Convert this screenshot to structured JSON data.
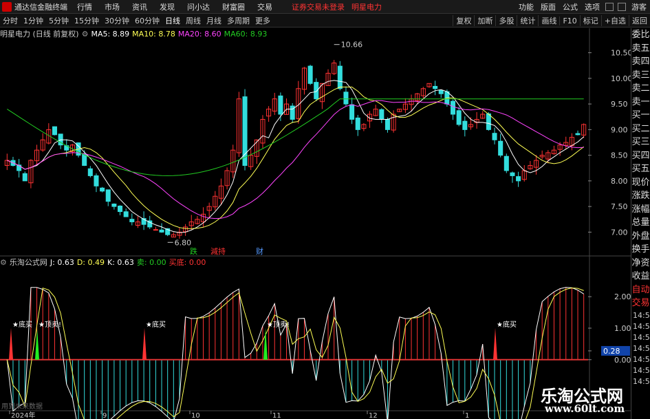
{
  "menubar": {
    "app_name": "通达信金融终端",
    "items": [
      "行情",
      "市场",
      "资讯",
      "发现",
      "问小达",
      "财富圈",
      "交易"
    ],
    "alert": "证券交易未登录",
    "stock_name": "明星电力",
    "right_items": [
      "功能",
      "版面",
      "公式",
      "选项"
    ],
    "guest": "游客"
  },
  "periods": [
    "分时",
    "1分钟",
    "5分钟",
    "15分钟",
    "30分钟",
    "60分钟",
    "日线",
    "周线",
    "月线",
    "多周期",
    "更多"
  ],
  "active_period": "日线",
  "tools": [
    "复权",
    "加断",
    "多股",
    "统计",
    "画线",
    "F10",
    "标记",
    "+自选",
    "返回"
  ],
  "main_legend": {
    "title": "明星电力 (日线 前复权)",
    "ma5": "MA5: 8.89",
    "ma10": "MA10: 8.78",
    "ma20": "MA20: 8.60",
    "ma60": "MA60: 8.93"
  },
  "sub_legend": {
    "title": "乐淘公式网",
    "j": "J: 0.63",
    "d": "D: 0.49",
    "k": "K: 0.63",
    "sell": "卖: 0.00",
    "buy": "买底: 0.00"
  },
  "price_axis": [
    "10.50",
    "10.00",
    "9.50",
    "9.00",
    "8.50",
    "8.00",
    "7.50",
    "7.00"
  ],
  "high_label": "10.66",
  "low_label": "6.80",
  "event_labels": [
    "跌",
    "減持",
    "财"
  ],
  "sub_axis": [
    "2.00",
    "1.00",
    "0.28",
    "0.00"
  ],
  "time_axis": [
    "2024年",
    "9",
    "10",
    "11",
    "12",
    "1"
  ],
  "signals": {
    "buy": "底买",
    "sell": "顶卖!"
  },
  "right_panel": [
    "委比",
    "卖五",
    "卖四",
    "卖三",
    "卖二",
    "卖一",
    "买一",
    "买二",
    "买三",
    "买四",
    "买五",
    "现价",
    "涨跌",
    "涨幅",
    "总量",
    "外盘",
    "换手",
    "净资",
    "收益",
    "自动",
    "交易"
  ],
  "right_times": [
    "14:5",
    "14:5",
    "14:5",
    "14:5",
    "14:5",
    "14:5",
    "14:5"
  ],
  "future_note": "用到未来数据",
  "watermark": {
    "line1": "乐淘公式网",
    "line2": "www.60lt.com"
  },
  "colors": {
    "up": "#ff3333",
    "down": "#33dddd",
    "ma5": "#ffffff",
    "ma10": "#ffff55",
    "ma20": "#ff44ff",
    "ma60": "#22cc22"
  },
  "chart_data": {
    "type": "candlestick",
    "y_range": [
      6.75,
      10.75
    ],
    "closes": [
      8.4,
      8.3,
      8.2,
      8.0,
      8.4,
      8.6,
      8.8,
      9.0,
      8.9,
      8.7,
      8.6,
      8.7,
      8.5,
      8.3,
      8.1,
      7.9,
      7.8,
      7.6,
      7.5,
      7.4,
      7.3,
      7.2,
      7.2,
      7.15,
      7.1,
      7.05,
      7.0,
      6.95,
      6.95,
      7.0,
      7.1,
      7.2,
      7.25,
      7.35,
      7.5,
      7.7,
      7.9,
      8.2,
      8.6,
      9.6,
      8.3,
      8.5,
      8.8,
      9.2,
      9.4,
      9.6,
      9.3,
      9.5,
      9.2,
      9.8,
      10.2,
      9.9,
      9.6,
      9.9,
      10.1,
      10.3,
      9.8,
      9.5,
      9.2,
      9.0,
      9.1,
      9.3,
      9.4,
      9.2,
      9.0,
      9.3,
      9.4,
      9.5,
      9.6,
      9.7,
      9.8,
      9.9,
      9.8,
      9.7,
      9.5,
      9.3,
      9.1,
      9.0,
      9.1,
      9.2,
      9.3,
      9.0,
      8.8,
      8.5,
      8.2,
      8.1,
      8.0,
      8.2,
      8.3,
      8.4,
      8.5,
      8.55,
      8.6,
      8.7,
      8.75,
      8.85,
      8.9,
      9.1
    ]
  }
}
